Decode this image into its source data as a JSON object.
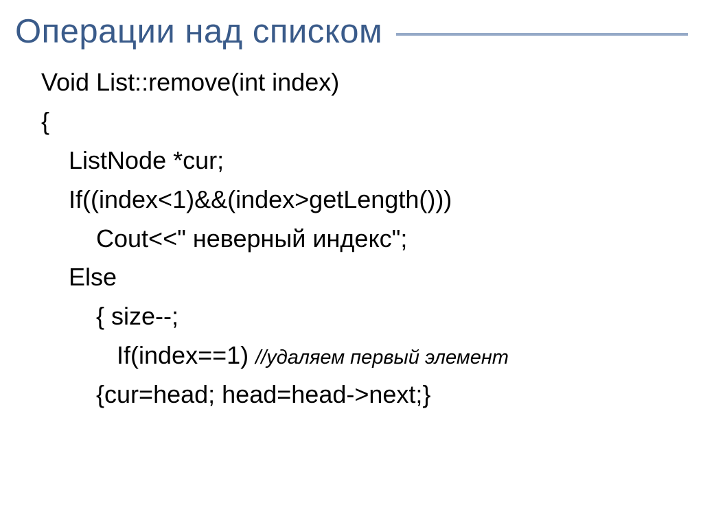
{
  "slide": {
    "title": "Операции над списком",
    "code": {
      "l1": "Void List::remove(int index)",
      "l2": "{",
      "l3": "    ListNode *cur;",
      "l4": "    If((index<1)&&(index>getLength()))",
      "l5": "        Cout<<\" неверный индекс\";",
      "l6": "    Else",
      "l7a": "        { size--;",
      "l7b": "           If(index==1) ",
      "l7comment": "//удаляем первый элемент",
      "l8": "        {cur=head; head=head->next;}"
    }
  }
}
